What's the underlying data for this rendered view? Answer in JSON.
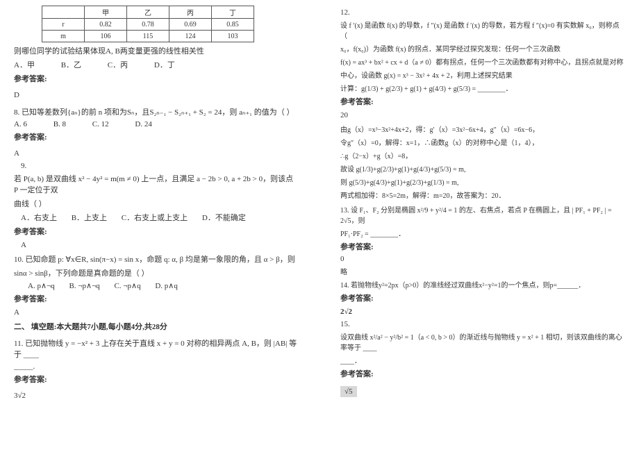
{
  "left": {
    "table": {
      "header": [
        "",
        "甲",
        "乙",
        "丙",
        "丁"
      ],
      "row_r_label": "r",
      "row_r": [
        "0.82",
        "0.78",
        "0.69",
        "0.85"
      ],
      "row_m_label": "m",
      "row_m": [
        "106",
        "115",
        "124",
        "103"
      ]
    },
    "intro": "则哪位同学的试验结果体现A, B两变量更强的线性相关性",
    "opts7": {
      "a": "A．甲",
      "b": "B．乙",
      "c": "C．丙",
      "d": "D．丁"
    },
    "ans_label": "参考答案:",
    "ans7": "D",
    "q8": "8. 已知等差数列{aₙ}的前 n 项和为Sₙ，且S₂ₙ₋₁ − S₂ₙ₊₁ + S₂ = 24，则 aₙ₊₁ 的值为（    ）",
    "opts8": {
      "a": "A. 6",
      "b": "B. 8",
      "c": "C. 12",
      "d": "D. 24"
    },
    "ans8": "A",
    "q9title": "9.",
    "q9line1": "若 P(a, b) 是双曲线 x² − 4y² = m(m ≠ 0) 上一点，且满足 a − 2b > 0, a + 2b > 0，则该点 P 一定位于双",
    "q9line2": "曲线（    ）",
    "opts9": {
      "a": "A．右支上",
      "b": "B．上支上",
      "c": "C．右支上或上支上",
      "d": "D．不能确定"
    },
    "ans9": "A",
    "q10line1": "10. 已知命题 p: ∀x∈R, sin(π−x) = sin x，命题 q: α, β 均是第一象限的角，且 α > β，则",
    "q10line2": "sinα > sinβ，下列命题是真命题的是（    ）",
    "opts10": {
      "a": "A. p∧¬q",
      "b": "B. ¬p∧¬q",
      "c": "C. ¬p∧q",
      "d": "D. p∧q"
    },
    "ans10": "A",
    "section2": "二、 填空题:本大题共7小题,每小题4分,共28分",
    "q11": "11. 已知抛物线 y = −x² + 3 上存在关于直线 x + y = 0 对称的相异两点 A, B，则 |AB| 等于 ____",
    "ans11": "3√2"
  },
  "right": {
    "q12title": "12.",
    "q12l1": "设 f ′(x) 是函数 f(x) 的导数，f ″(x) 是函数 f ′(x) 的导数，若方程 f ″(x)=0 有实数解 x₀，则称点（",
    "q12l2": "x₀，f(x₀)）为函数 f(x) 的拐点．某同学经过探究发现：任何一个三次函数",
    "q12l3": "f(x) = ax³ + bx² + cx + d（a ≠ 0）都有拐点，任何一个三次函数都有对称中心，且拐点就是对称",
    "q12l4": "中心，设函数 g(x) = x³ − 3x² + 4x + 2，利用上述探究结果",
    "q12l5a": "计算：g(",
    "q12l5b": ") + g(",
    "q12l5c": ") + g(1) + g(",
    "q12l5d": ") + g(",
    "q12l5e": ") = ________．",
    "ans_label": "参考答案:",
    "ans12": "20",
    "expl1": "由g（x）=x³−3x²+4x+2，得：g′（x）=3x²−6x+4，g″（x）=6x−6，",
    "expl2": "令g″（x）=0，解得：x=1，∴函数g（x）的对称中心是（1，4），",
    "expl3": "∴g（2−x）+g（x）=8，",
    "expl4a1": "故设 g(",
    "expl4a2": ")+g(",
    "expl4a3": ")+g(1)+g(",
    "expl4a4": ")+g(",
    "expl4a5": ") = m,",
    "expl4b1": "则 g(",
    "expl4b2": ")+g(",
    "expl4b3": ")+g(1)+g(",
    "expl4b4": ")+g(",
    "expl4b5": ") = m,",
    "expl5": "两式相加得：8×5=2m，解得：m=20，故答案为：20．",
    "q13l1": "13. 设 F₁、F₂ 分别是椭圆  x²/9 + y²/4 = 1 的左、右焦点，若点 P 在椭圆上，且 | PF₁ + PF₂ | = 2√5，则",
    "q13l2": "PF₁·PF₂ = ________．",
    "ans13": "0",
    "ans13b": "略",
    "q14": "14. 若抛物线y²=2px（p>0）的准线经过双曲线x²−y²=1的一个焦点，则p=______．",
    "ans14": "2√2",
    "q15title": "15.",
    "q15l1": "设双曲线 x²/a² − y²/b² = 1（a < 0, b > 0）的渐近线与抛物线 y = x² + 1 相切，则该双曲线的离心率等于 ____",
    "q15l2": "____．",
    "ans15": "√5"
  }
}
